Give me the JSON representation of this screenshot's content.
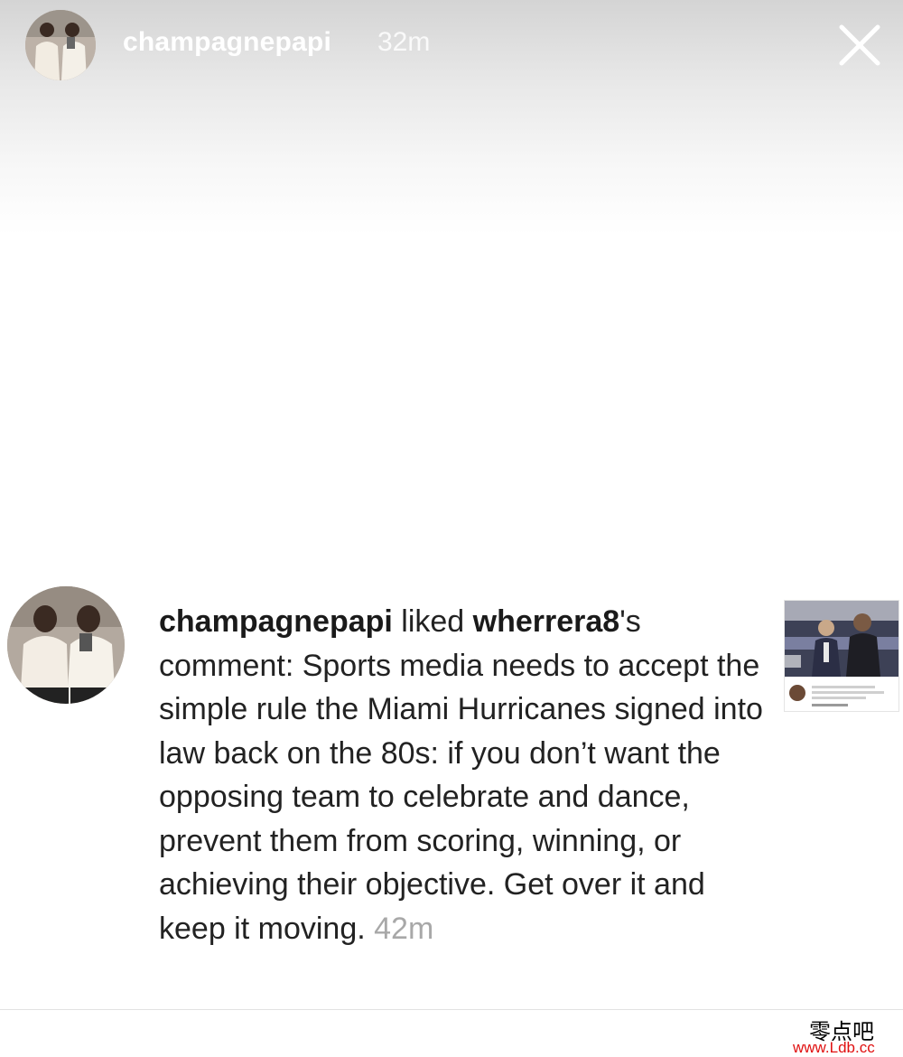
{
  "story": {
    "username": "champagnepapi",
    "time": "32m"
  },
  "notification": {
    "actor": "champagnepapi",
    "verb": " liked ",
    "target_user": "wherrera8",
    "possessive": "'s",
    "comment_prefix": " comment: ",
    "comment": "Sports media needs to accept the simple rule the Miami Hurricanes signed into law back on the 80s: if you don’t want the opposing team to celebrate and dance, prevent them from scoring, winning, or achieving their objective. Get over it and keep it moving.",
    "time": "42m"
  },
  "watermark": {
    "chinese": "零点吧",
    "url": "www.Ldb.cc"
  },
  "icons": {
    "close": "close-icon"
  }
}
